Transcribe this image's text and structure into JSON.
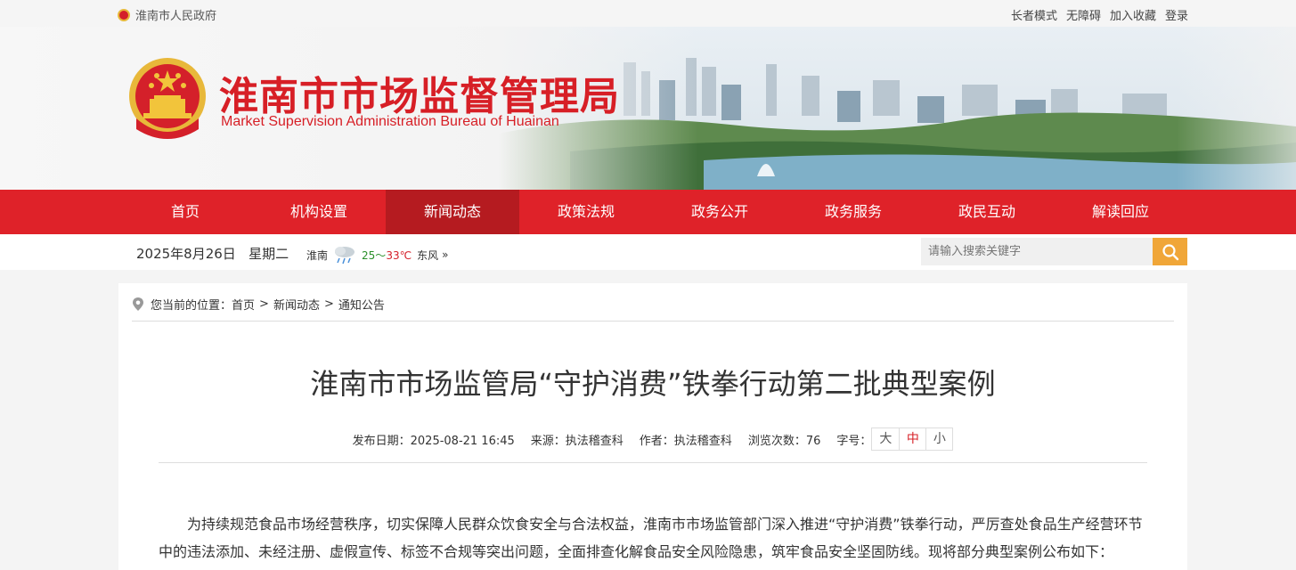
{
  "topbar": {
    "gov_name": "淮南市人民政府",
    "links": [
      "长者模式",
      "无障碍",
      "加入收藏",
      "登录"
    ]
  },
  "header": {
    "title_cn": "淮南市市场监督管理局",
    "title_en": "Market Supervision Administration Bureau of Huainan"
  },
  "nav": {
    "items": [
      "首页",
      "机构设置",
      "新闻动态",
      "政策法规",
      "政务公开",
      "政务服务",
      "政民互动",
      "解读回应"
    ],
    "active": "新闻动态"
  },
  "info": {
    "date": "2025年8月26日",
    "weekday": "星期二",
    "city": "淮南",
    "temp_low": "25",
    "temp_sep": "～",
    "temp_high": "33℃",
    "wind": "东风",
    "more": "»",
    "search_placeholder": "请输入搜索关键字"
  },
  "breadcrumb": {
    "prefix": "您当前的位置：",
    "items": [
      "首页",
      "新闻动态",
      "通知公告"
    ],
    "separator": ">"
  },
  "article": {
    "title": "淮南市市场监管局“守护消费”铁拳行动第二批典型案例",
    "publish": "发布日期：2025-08-21 16:45",
    "source": "来源：执法稽查科",
    "author": "作者：执法稽查科",
    "views": "浏览次数：76",
    "font_label": "字号：",
    "font_sizes": [
      "大",
      "中",
      "小"
    ],
    "active_font": "中",
    "body": "为持续规范食品市场经营秩序，切实保障人民群众饮食安全与合法权益，淮南市市场监管部门深入推进“守护消费”铁拳行动，严厉查处食品生产经营环节中的违法添加、未经注册、虚假宣传、标签不合规等突出问题，全面排查化解食品安全风险隐患，筑牢食品安全坚固防线。现将部分典型案例公布如下："
  },
  "colors": {
    "brand_red": "#df2229",
    "nav_active": "#b51b20",
    "search_button": "#f0a638"
  },
  "icons": {
    "emblem": "national-emblem-icon",
    "weather": "rain-cloud-icon",
    "search": "search-icon",
    "location": "location-pin-icon"
  }
}
